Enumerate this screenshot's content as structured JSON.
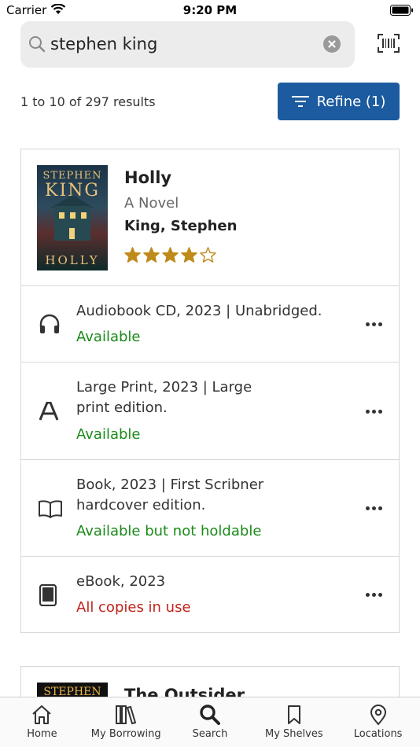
{
  "status_bar": {
    "carrier": "Carrier",
    "time": "9:20 PM"
  },
  "search": {
    "query": "stephen king"
  },
  "results_count": "1 to 10 of 297 results",
  "refine_label": "Refine (1)",
  "result": {
    "title": "Holly",
    "subtitle": "A Novel",
    "author": "King, Stephen",
    "rating": 4,
    "rating_max": 5,
    "cover_text": [
      "STEPHEN",
      "KING",
      "HOLLY"
    ],
    "formats": [
      {
        "icon": "headphones-icon",
        "description": "Audiobook CD, 2023 | Unabridged.",
        "status": "Available",
        "status_type": "ok"
      },
      {
        "icon": "large-print-icon",
        "description": "Large Print, 2023 | Large print edition.",
        "status": "Available",
        "status_type": "ok"
      },
      {
        "icon": "book-icon",
        "description": "Book, 2023 | First Scribner hardcover edition.",
        "status": "Available but not holdable",
        "status_type": "ok"
      },
      {
        "icon": "tablet-icon",
        "description": "eBook, 2023",
        "status": "All copies in use",
        "status_type": "bad"
      }
    ]
  },
  "next_result": {
    "title": "The Outsider",
    "cover_text": "STEPHEN"
  },
  "tabs": [
    {
      "label": "Home",
      "icon": "home-icon"
    },
    {
      "label": "My Borrowing",
      "icon": "books-icon"
    },
    {
      "label": "Search",
      "icon": "search-icon",
      "active": true
    },
    {
      "label": "My Shelves",
      "icon": "bookmark-icon"
    },
    {
      "label": "Locations",
      "icon": "location-pin-icon"
    }
  ],
  "colors": {
    "accent": "#1c5b9f",
    "available": "#1a8a1a",
    "unavailable": "#c0231a",
    "star": "#c08a1a"
  }
}
